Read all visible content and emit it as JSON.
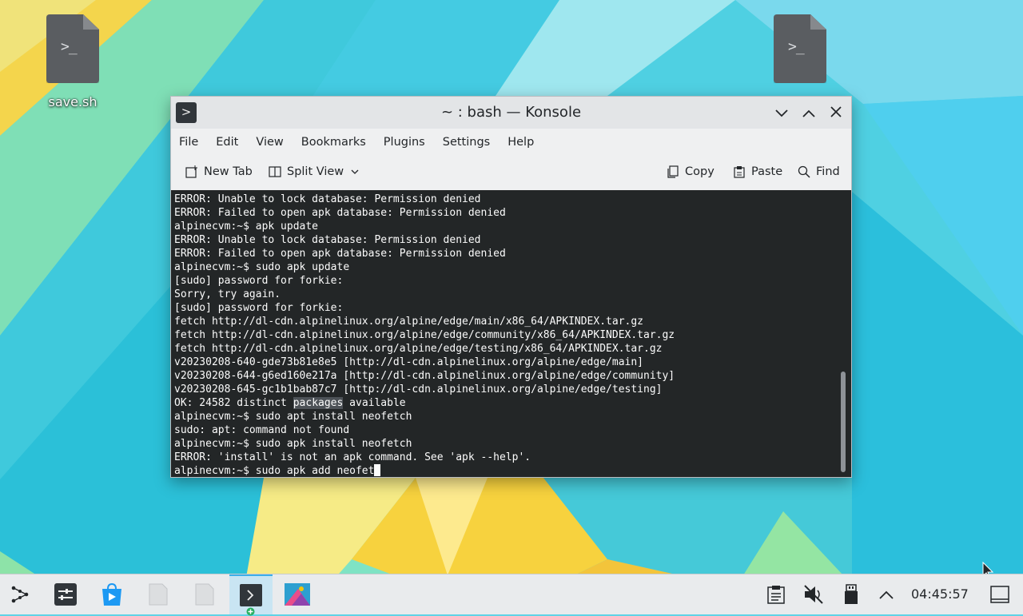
{
  "desktop": {
    "icons": [
      {
        "label": "save.sh",
        "glyph": ">_"
      },
      {
        "label": "",
        "glyph": ">_"
      }
    ]
  },
  "window": {
    "app_icon_glyph": ">",
    "title": "~ : bash — Konsole",
    "controls": {
      "minimize": "⌵",
      "maximize": "˄",
      "close": "✕"
    },
    "menu": [
      "File",
      "Edit",
      "View",
      "Bookmarks",
      "Plugins",
      "Settings",
      "Help"
    ],
    "toolbar": {
      "new_tab": "New Tab",
      "split_view": "Split View",
      "copy": "Copy",
      "paste": "Paste",
      "find": "Find"
    },
    "terminal": {
      "lines": [
        "ERROR: Unable to lock database: Permission denied",
        "ERROR: Failed to open apk database: Permission denied",
        "alpinecvm:~$ apk update",
        "ERROR: Unable to lock database: Permission denied",
        "ERROR: Failed to open apk database: Permission denied",
        "alpinecvm:~$ sudo apk update",
        "[sudo] password for forkie:",
        "Sorry, try again.",
        "[sudo] password for forkie:",
        "fetch http://dl-cdn.alpinelinux.org/alpine/edge/main/x86_64/APKINDEX.tar.gz",
        "fetch http://dl-cdn.alpinelinux.org/alpine/edge/community/x86_64/APKINDEX.tar.gz",
        "fetch http://dl-cdn.alpinelinux.org/alpine/edge/testing/x86_64/APKINDEX.tar.gz",
        "v20230208-640-gde73b81e8e5 [http://dl-cdn.alpinelinux.org/alpine/edge/main]",
        "v20230208-644-g6ed160e217a [http://dl-cdn.alpinelinux.org/alpine/edge/community]",
        "v20230208-645-gc1b1bab87c7 [http://dl-cdn.alpinelinux.org/alpine/edge/testing]"
      ],
      "ok_line": {
        "before": "OK: 24582 distinct ",
        "highlight": "packages",
        "after": " available"
      },
      "lines_after": [
        "alpinecvm:~$ sudo apt install neofetch",
        "sudo: apt: command not found",
        "alpinecvm:~$ sudo apk install neofetch",
        "ERROR: 'install' is not an apk command. See 'apk --help'."
      ],
      "prompt_line": "alpinecvm:~$ sudo apk add neofet"
    }
  },
  "taskbar": {
    "clock": "04:45:57",
    "items": [
      "app-launcher-icon",
      "system-settings-icon",
      "discover-icon",
      "file-icon",
      "file-icon",
      "konsole-icon",
      "screenshot-icon"
    ],
    "tray": [
      "clipboard-icon",
      "volume-muted-icon",
      "usb-device-icon",
      "tray-expand-icon",
      "show-desktop-icon"
    ]
  }
}
